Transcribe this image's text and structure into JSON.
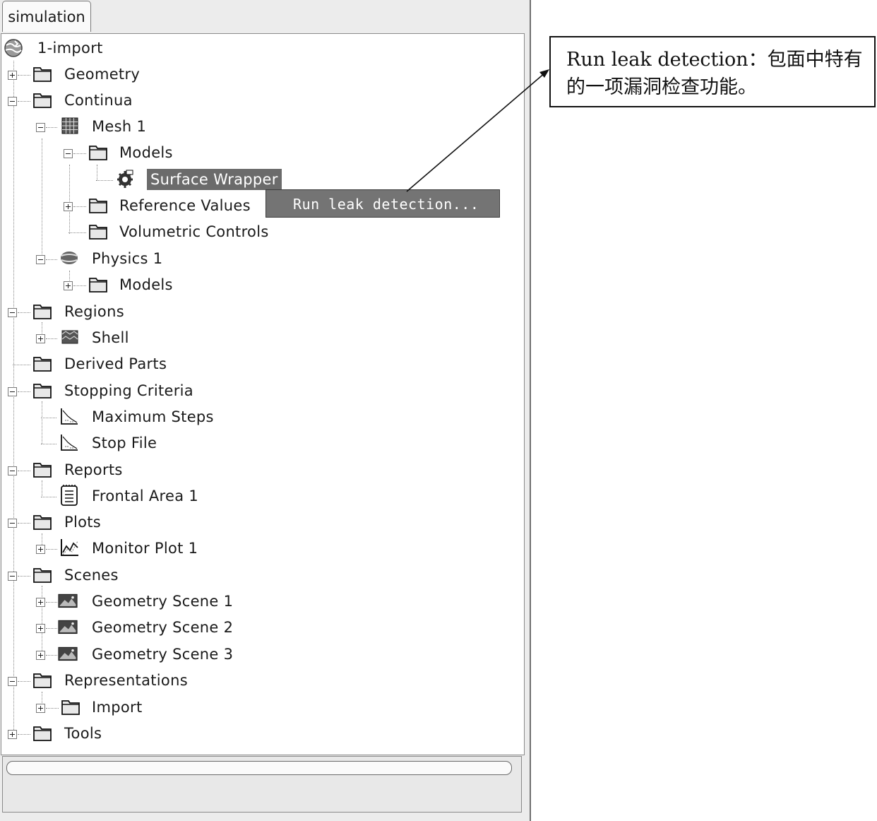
{
  "tab_label": "simulation",
  "tree": {
    "root": "1-import",
    "items": {
      "geometry": "Geometry",
      "continua": "Continua",
      "mesh1": "Mesh 1",
      "models1": "Models",
      "surface_wrapper": "Surface Wrapper",
      "reference_values": "Reference Values",
      "volumetric_controls": "Volumetric Controls",
      "physics1": "Physics 1",
      "models2": "Models",
      "regions": "Regions",
      "shell": "Shell",
      "derived_parts": "Derived Parts",
      "stopping_criteria": "Stopping Criteria",
      "maximum_steps": "Maximum Steps",
      "stop_file": "Stop File",
      "reports": "Reports",
      "frontal_area": "Frontal Area 1",
      "plots": "Plots",
      "monitor_plot": "Monitor Plot 1",
      "scenes": "Scenes",
      "geometry_scene1": "Geometry Scene 1",
      "geometry_scene2": "Geometry Scene 2",
      "geometry_scene3": "Geometry Scene 3",
      "representations": "Representations",
      "import": "Import",
      "tools": "Tools"
    }
  },
  "context_menu": {
    "run_leak_detection": "Run leak detection..."
  },
  "annotation": {
    "text": "Run leak detection：包面中特有的一项漏洞检查功能。"
  }
}
